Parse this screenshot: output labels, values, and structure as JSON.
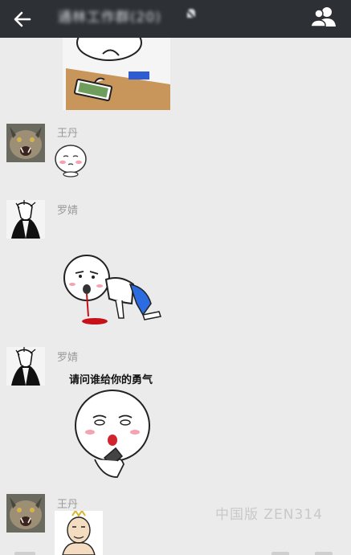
{
  "titlebar": {
    "title": "通林工作群(20)",
    "back_icon": "arrow-left-icon",
    "mute_icon": "bell-muted-icon",
    "members_icon": "group-members-icon",
    "background": "#2d3135"
  },
  "messages": [
    {
      "sender": "王丹",
      "avatar": "lynx-avatar",
      "content": "blushing-face-sticker"
    },
    {
      "sender": "罗婧",
      "avatar": "sketch-portrait-avatar",
      "content": "crawling-bleeding-sticker"
    },
    {
      "sender": "罗婧",
      "avatar": "sketch-portrait-avatar",
      "content": "shocked-holding-phone-sticker",
      "caption": "请问谁给你的勇气"
    },
    {
      "sender": "王丹",
      "avatar": "lynx-avatar",
      "content": "partial-sticker"
    }
  ],
  "top_sticker": "phone-on-desk-sticker",
  "watermark": "中国版 ZEN314",
  "colors": {
    "chat_background": "#ebebeb",
    "name_text": "#999a9b"
  }
}
